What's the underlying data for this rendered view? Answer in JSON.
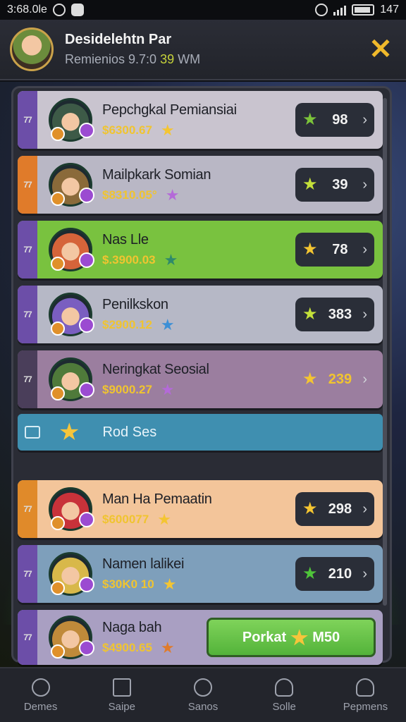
{
  "status_bar": {
    "time": "3:68.0le",
    "right_time": "147"
  },
  "header": {
    "title": "Desidelehtn Par",
    "subtitle_text": "Remienios 9.7:0",
    "subtitle_accent": "39",
    "subtitle_tail": "WM",
    "close_icon": "✕"
  },
  "rows": [
    {
      "rank": "77",
      "name": "Pepchgkal Pemiansiai",
      "score": "$6300.67",
      "mini_icon": "star-icon",
      "value": "98",
      "tab_color": "#6c4ea8",
      "row_color": "#c9c4cf",
      "mini_color": "#f4c531",
      "pill_star_color": "#7cc43a"
    },
    {
      "rank": "77",
      "name": "Mailpkark Somian",
      "score": "$8310.05°",
      "mini_icon": "star-icon",
      "value": "39",
      "tab_color": "#e07b2a",
      "row_color": "#b9b7c5",
      "mini_color": "#b46ad8",
      "pill_star_color": "#c4e03a"
    },
    {
      "rank": "77",
      "name": "Nas Lle",
      "score": "$.3900.03",
      "mini_icon": "star-icon",
      "value": "78",
      "tab_color": "#6c4ea8",
      "row_color": "#79c23f",
      "mini_color": "#2f8a6a",
      "pill_star_color": "#f4c531"
    },
    {
      "rank": "77",
      "name": "Penilkskon",
      "score": "$2900.12",
      "mini_icon": "star-icon",
      "value": "383",
      "tab_color": "#6c4ea8",
      "row_color": "#b6b8c6",
      "mini_color": "#3c8fd6",
      "pill_star_color": "#c4e03a"
    },
    {
      "rank": "77",
      "name": "Neringkat Seosial",
      "score": "$9000.27",
      "mini_icon": "star-icon",
      "value": "239",
      "tab_color": "#4a3e5a",
      "row_color": "#9b7e9f",
      "mini_color": "#b46ad8",
      "pill_star_color": "#f4c531"
    },
    {
      "rank": "77",
      "name": "Man Ha Pemaatin",
      "score": "$600077",
      "mini_icon": "star-icon",
      "value": "298",
      "tab_color": "#e08a2a",
      "row_color": "#f3c59a",
      "mini_color": "#f4c531",
      "pill_star_color": "#f4c531"
    },
    {
      "rank": "77",
      "name": "Namen lalikei",
      "score": "$30K0 10",
      "mini_icon": "star-icon",
      "value": "210",
      "tab_color": "#6c4ea8",
      "row_color": "#7e9fbb",
      "mini_color": "#f4c531",
      "pill_star_color": "#4fc43a"
    },
    {
      "rank": "77",
      "name": "Naga bah",
      "score": "$4900.65",
      "mini_icon": "star-icon",
      "value": "",
      "tab_color": "#6c4ea8",
      "row_color": "#a99fc2",
      "mini_color": "#e07b2a",
      "pill_star_color": "#f4c531"
    }
  ],
  "banner": {
    "text": "Rod Ses"
  },
  "claim_button": {
    "label_left": "Porkat",
    "label_right": "M50"
  },
  "nav": [
    {
      "label": "Demes",
      "icon": "dome-icon"
    },
    {
      "label": "Saipe",
      "icon": "home-icon"
    },
    {
      "label": "Sanos",
      "icon": "circle-icon"
    },
    {
      "label": "Solle",
      "icon": "person-icon"
    },
    {
      "label": "Pepmens",
      "icon": "group-icon"
    }
  ]
}
